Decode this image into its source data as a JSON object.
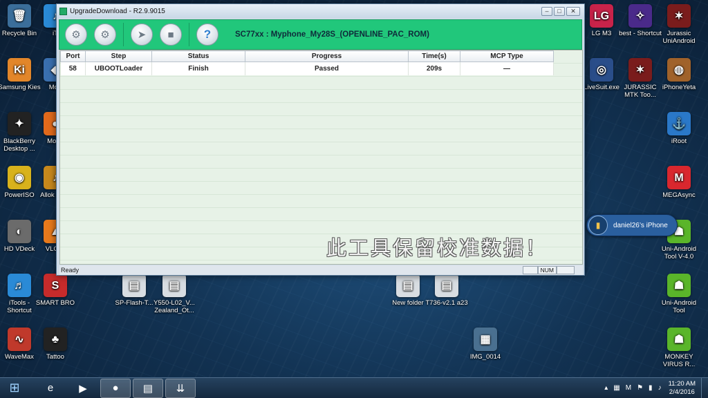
{
  "desktop_icons_left": [
    {
      "label": "Recycle Bin",
      "glyph": "🗑",
      "color": "#3b6e9a"
    },
    {
      "label": "Samsung Kies",
      "glyph": "Ki",
      "color": "#e2862a"
    },
    {
      "label": "BlackBerry Desktop ...",
      "glyph": "✦",
      "color": "#222222"
    },
    {
      "label": "PowerISO",
      "glyph": "◉",
      "color": "#d8b21c"
    },
    {
      "label": "HD VDeck",
      "glyph": "◐",
      "color": "#6b6b6b"
    },
    {
      "label": "iTools - Shortcut",
      "glyph": "♬",
      "color": "#2a8ad6"
    },
    {
      "label": "WaveMax",
      "glyph": "∿",
      "color": "#c0392b"
    }
  ],
  "desktop_icons_left2": [
    {
      "label": "iT",
      "glyph": "♪",
      "color": "#2a8ad6"
    },
    {
      "label": "Mob",
      "glyph": "◆",
      "color": "#3a70b0"
    },
    {
      "label": "Mo Fi",
      "glyph": "●",
      "color": "#e26a1c"
    },
    {
      "label": "Allok AMR",
      "glyph": "♪",
      "color": "#c8891c"
    },
    {
      "label": "VLC pl",
      "glyph": "▲",
      "color": "#e87a1c"
    },
    {
      "label": "SMART BRO",
      "glyph": "S",
      "color": "#c72b2b"
    },
    {
      "label": "Tattoo",
      "glyph": "♣",
      "color": "#222222"
    }
  ],
  "desktop_icons_middle": [
    {
      "label": "SP-Flash-T...",
      "glyph": "▤",
      "color": "#d8dde2"
    },
    {
      "label": "Y550-L02_V... Zealand_Ot...",
      "glyph": "▤",
      "color": "#d8dde2"
    },
    {
      "label": "New folder",
      "glyph": "▤",
      "color": "#d8dde2"
    },
    {
      "label": "T736-v2.1 a23",
      "glyph": "▤",
      "color": "#d8dde2"
    },
    {
      "label": "IMG_0014",
      "glyph": "▦",
      "color": "#4a7090"
    }
  ],
  "desktop_icons_right1": [
    {
      "label": "LG M3",
      "glyph": "LG",
      "color": "#c8234a"
    },
    {
      "label": "LiveSuit.exe",
      "glyph": "◎",
      "color": "#2a4e8a"
    }
  ],
  "desktop_icons_right2": [
    {
      "label": "best - Shortcut",
      "glyph": "✧",
      "color": "#4a2a8a"
    },
    {
      "label": "JURASSIC MTK Too...",
      "glyph": "✶",
      "color": "#7a1c1c"
    }
  ],
  "desktop_icons_right3": [
    {
      "label": "Jurassic UniAndroid",
      "glyph": "✶",
      "color": "#7a1c1c"
    },
    {
      "label": "iPhoneYeta",
      "glyph": "◍",
      "color": "#a0622a"
    },
    {
      "label": "iRoot",
      "glyph": "⚓",
      "color": "#2a78c8"
    },
    {
      "label": "MEGAsync",
      "glyph": "M",
      "color": "#d9272e"
    },
    {
      "label": "Uni-Android Tool V-4.0",
      "glyph": "☗",
      "color": "#5ab52a"
    },
    {
      "label": "Uni-Android Tool",
      "glyph": "☗",
      "color": "#5ab52a"
    },
    {
      "label": "MONKEY VIRUS R...",
      "glyph": "☗",
      "color": "#5ab52a"
    }
  ],
  "window": {
    "title": "UpgradeDownload - R2.9.9015",
    "min_label": "–",
    "max_label": "□",
    "close_label": "✕",
    "toolbar_title": "SC77xx : Myphone_My28S_(OPENLINE_PAC_ROM)",
    "toolbar_glyphs": {
      "settings": "⚙",
      "options": "⚙",
      "start": "➤",
      "stop": "■",
      "help": "?"
    },
    "columns": [
      "Port",
      "Step",
      "Status",
      "Progress",
      "Time(s)",
      "MCP Type"
    ],
    "rows": [
      {
        "port": "58",
        "step": "UBOOTLoader",
        "status": "Finish",
        "progress": "Passed",
        "time": "209s",
        "mcp": "—"
      }
    ],
    "status_left": "Ready",
    "status_num": "NUM",
    "watermark": "此工具保留校准数据！"
  },
  "device_pill": {
    "name": "daniel26’s iPhone",
    "icon": "▮"
  },
  "taskbar": {
    "start_glyph": "⊞",
    "items": [
      {
        "name": "ie",
        "glyph": "e"
      },
      {
        "name": "media-player",
        "glyph": "▶"
      },
      {
        "name": "firefox",
        "glyph": "●"
      },
      {
        "name": "folder",
        "glyph": "▤"
      },
      {
        "name": "upgrade-download",
        "glyph": "⇊"
      }
    ],
    "tray_glyphs": [
      "▴",
      "▦",
      "M",
      "⚑",
      "▮",
      "♪"
    ],
    "clock_time": "11:20 AM",
    "clock_date": "2/4/2016"
  }
}
